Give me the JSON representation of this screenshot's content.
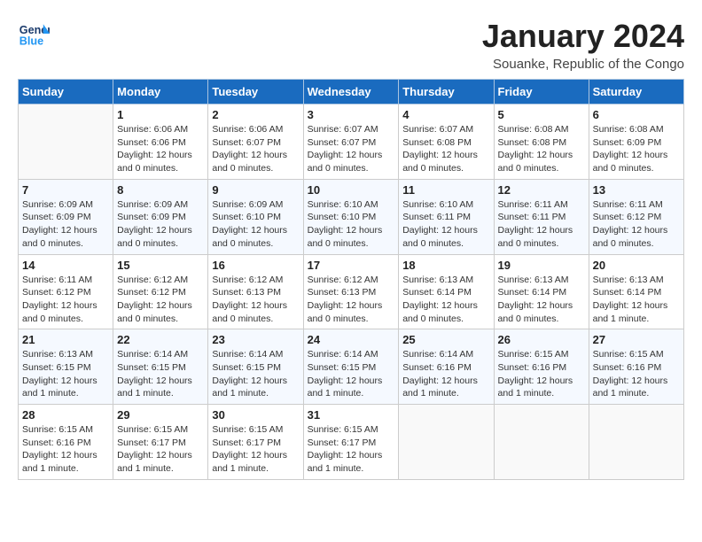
{
  "header": {
    "logo_line1": "General",
    "logo_line2": "Blue",
    "month": "January 2024",
    "location": "Souanke, Republic of the Congo"
  },
  "weekdays": [
    "Sunday",
    "Monday",
    "Tuesday",
    "Wednesday",
    "Thursday",
    "Friday",
    "Saturday"
  ],
  "weeks": [
    [
      {
        "day": "",
        "sunrise": "",
        "sunset": "",
        "daylight": ""
      },
      {
        "day": "1",
        "sunrise": "Sunrise: 6:06 AM",
        "sunset": "Sunset: 6:06 PM",
        "daylight": "Daylight: 12 hours and 0 minutes."
      },
      {
        "day": "2",
        "sunrise": "Sunrise: 6:06 AM",
        "sunset": "Sunset: 6:07 PM",
        "daylight": "Daylight: 12 hours and 0 minutes."
      },
      {
        "day": "3",
        "sunrise": "Sunrise: 6:07 AM",
        "sunset": "Sunset: 6:07 PM",
        "daylight": "Daylight: 12 hours and 0 minutes."
      },
      {
        "day": "4",
        "sunrise": "Sunrise: 6:07 AM",
        "sunset": "Sunset: 6:08 PM",
        "daylight": "Daylight: 12 hours and 0 minutes."
      },
      {
        "day": "5",
        "sunrise": "Sunrise: 6:08 AM",
        "sunset": "Sunset: 6:08 PM",
        "daylight": "Daylight: 12 hours and 0 minutes."
      },
      {
        "day": "6",
        "sunrise": "Sunrise: 6:08 AM",
        "sunset": "Sunset: 6:09 PM",
        "daylight": "Daylight: 12 hours and 0 minutes."
      }
    ],
    [
      {
        "day": "7",
        "sunrise": "Sunrise: 6:09 AM",
        "sunset": "Sunset: 6:09 PM",
        "daylight": "Daylight: 12 hours and 0 minutes."
      },
      {
        "day": "8",
        "sunrise": "Sunrise: 6:09 AM",
        "sunset": "Sunset: 6:09 PM",
        "daylight": "Daylight: 12 hours and 0 minutes."
      },
      {
        "day": "9",
        "sunrise": "Sunrise: 6:09 AM",
        "sunset": "Sunset: 6:10 PM",
        "daylight": "Daylight: 12 hours and 0 minutes."
      },
      {
        "day": "10",
        "sunrise": "Sunrise: 6:10 AM",
        "sunset": "Sunset: 6:10 PM",
        "daylight": "Daylight: 12 hours and 0 minutes."
      },
      {
        "day": "11",
        "sunrise": "Sunrise: 6:10 AM",
        "sunset": "Sunset: 6:11 PM",
        "daylight": "Daylight: 12 hours and 0 minutes."
      },
      {
        "day": "12",
        "sunrise": "Sunrise: 6:11 AM",
        "sunset": "Sunset: 6:11 PM",
        "daylight": "Daylight: 12 hours and 0 minutes."
      },
      {
        "day": "13",
        "sunrise": "Sunrise: 6:11 AM",
        "sunset": "Sunset: 6:12 PM",
        "daylight": "Daylight: 12 hours and 0 minutes."
      }
    ],
    [
      {
        "day": "14",
        "sunrise": "Sunrise: 6:11 AM",
        "sunset": "Sunset: 6:12 PM",
        "daylight": "Daylight: 12 hours and 0 minutes."
      },
      {
        "day": "15",
        "sunrise": "Sunrise: 6:12 AM",
        "sunset": "Sunset: 6:12 PM",
        "daylight": "Daylight: 12 hours and 0 minutes."
      },
      {
        "day": "16",
        "sunrise": "Sunrise: 6:12 AM",
        "sunset": "Sunset: 6:13 PM",
        "daylight": "Daylight: 12 hours and 0 minutes."
      },
      {
        "day": "17",
        "sunrise": "Sunrise: 6:12 AM",
        "sunset": "Sunset: 6:13 PM",
        "daylight": "Daylight: 12 hours and 0 minutes."
      },
      {
        "day": "18",
        "sunrise": "Sunrise: 6:13 AM",
        "sunset": "Sunset: 6:14 PM",
        "daylight": "Daylight: 12 hours and 0 minutes."
      },
      {
        "day": "19",
        "sunrise": "Sunrise: 6:13 AM",
        "sunset": "Sunset: 6:14 PM",
        "daylight": "Daylight: 12 hours and 0 minutes."
      },
      {
        "day": "20",
        "sunrise": "Sunrise: 6:13 AM",
        "sunset": "Sunset: 6:14 PM",
        "daylight": "Daylight: 12 hours and 1 minute."
      }
    ],
    [
      {
        "day": "21",
        "sunrise": "Sunrise: 6:13 AM",
        "sunset": "Sunset: 6:15 PM",
        "daylight": "Daylight: 12 hours and 1 minute."
      },
      {
        "day": "22",
        "sunrise": "Sunrise: 6:14 AM",
        "sunset": "Sunset: 6:15 PM",
        "daylight": "Daylight: 12 hours and 1 minute."
      },
      {
        "day": "23",
        "sunrise": "Sunrise: 6:14 AM",
        "sunset": "Sunset: 6:15 PM",
        "daylight": "Daylight: 12 hours and 1 minute."
      },
      {
        "day": "24",
        "sunrise": "Sunrise: 6:14 AM",
        "sunset": "Sunset: 6:15 PM",
        "daylight": "Daylight: 12 hours and 1 minute."
      },
      {
        "day": "25",
        "sunrise": "Sunrise: 6:14 AM",
        "sunset": "Sunset: 6:16 PM",
        "daylight": "Daylight: 12 hours and 1 minute."
      },
      {
        "day": "26",
        "sunrise": "Sunrise: 6:15 AM",
        "sunset": "Sunset: 6:16 PM",
        "daylight": "Daylight: 12 hours and 1 minute."
      },
      {
        "day": "27",
        "sunrise": "Sunrise: 6:15 AM",
        "sunset": "Sunset: 6:16 PM",
        "daylight": "Daylight: 12 hours and 1 minute."
      }
    ],
    [
      {
        "day": "28",
        "sunrise": "Sunrise: 6:15 AM",
        "sunset": "Sunset: 6:16 PM",
        "daylight": "Daylight: 12 hours and 1 minute."
      },
      {
        "day": "29",
        "sunrise": "Sunrise: 6:15 AM",
        "sunset": "Sunset: 6:17 PM",
        "daylight": "Daylight: 12 hours and 1 minute."
      },
      {
        "day": "30",
        "sunrise": "Sunrise: 6:15 AM",
        "sunset": "Sunset: 6:17 PM",
        "daylight": "Daylight: 12 hours and 1 minute."
      },
      {
        "day": "31",
        "sunrise": "Sunrise: 6:15 AM",
        "sunset": "Sunset: 6:17 PM",
        "daylight": "Daylight: 12 hours and 1 minute."
      },
      {
        "day": "",
        "sunrise": "",
        "sunset": "",
        "daylight": ""
      },
      {
        "day": "",
        "sunrise": "",
        "sunset": "",
        "daylight": ""
      },
      {
        "day": "",
        "sunrise": "",
        "sunset": "",
        "daylight": ""
      }
    ]
  ]
}
